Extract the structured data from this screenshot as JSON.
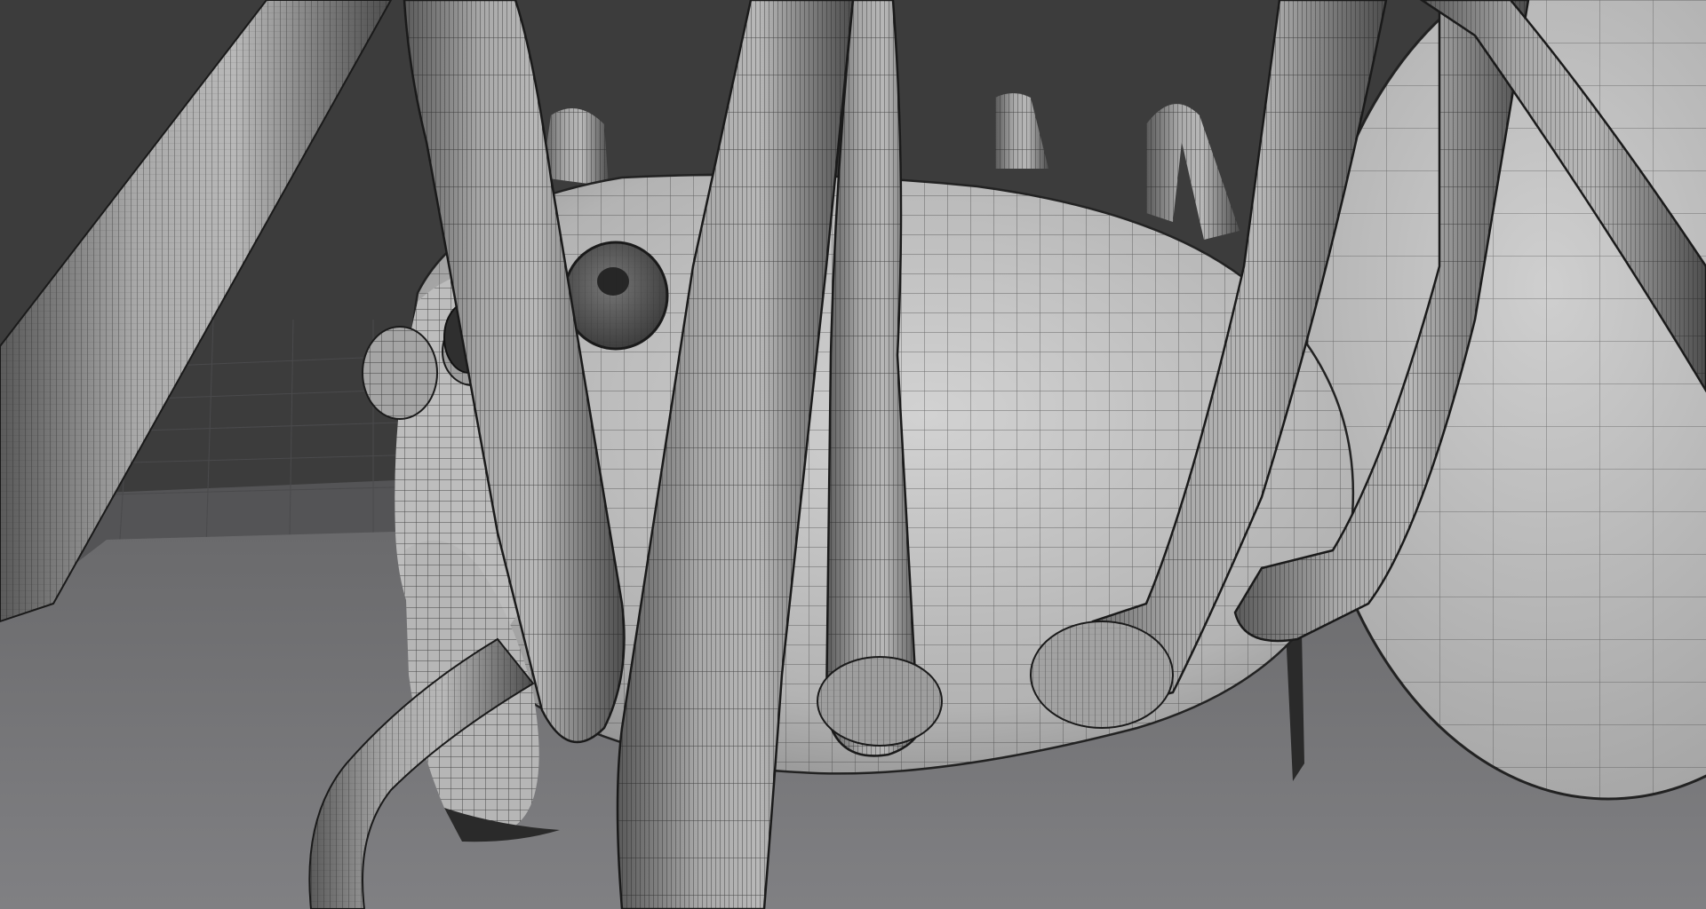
{
  "scene": {
    "subject": "spider",
    "render_mode": "wireframe-on-shaded",
    "colors": {
      "background": "#3c3c3c",
      "floor": "#7a7a7c",
      "floor_far": "#5f5f61",
      "mesh_light": "#c9c9c9",
      "mesh_mid": "#a7a7a7",
      "mesh_dark": "#6e6e6e",
      "wire": "#1a1a1a",
      "eye": "#4a4a4a",
      "grid_line": "#4a4a4a"
    }
  }
}
